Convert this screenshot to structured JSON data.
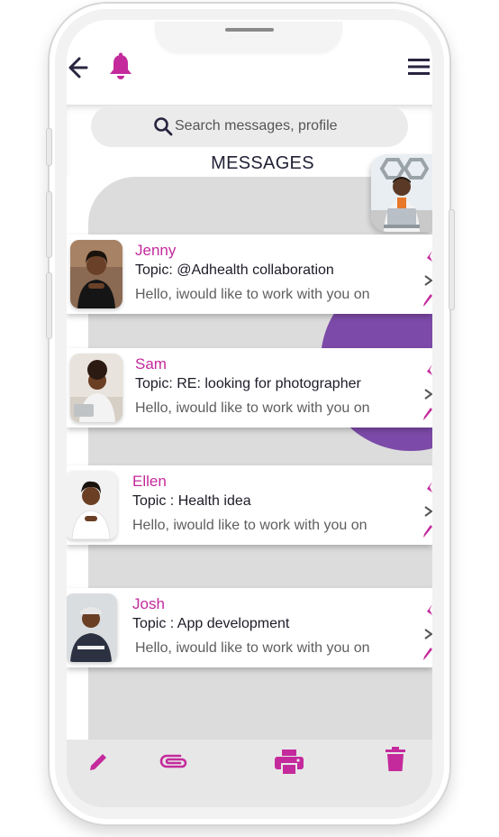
{
  "header": {
    "back_icon": "arrow-left-icon",
    "notification_icon": "bell-icon",
    "menu_icon": "hamburger-menu-icon"
  },
  "search": {
    "placeholder": "Search messages, profile",
    "icon": "search-icon"
  },
  "page_title": "MESSAGES",
  "colors": {
    "accent": "#c42a9c",
    "purple": "#7c4aa8",
    "panel_gray": "#dcdcdc",
    "text_dark": "#1c1c28"
  },
  "messages": [
    {
      "name": "Jenny",
      "topic": "Topic: @Adhealth collaboration",
      "preview": "Hello, iwould like to work with you on"
    },
    {
      "name": "Sam",
      "topic": "Topic: RE: looking for photographer",
      "preview": "Hello, iwould like to work with you on"
    },
    {
      "name": "Ellen",
      "topic": "Topic : Health idea",
      "preview": "Hello, iwould like to work with you on"
    },
    {
      "name": "Josh",
      "topic": "Topic : App development",
      "preview": "Hello, iwould like to work with you on"
    }
  ],
  "toolbar": {
    "icons": [
      "pencil-icon",
      "paperclip-icon",
      "printer-icon",
      "trash-icon"
    ]
  }
}
